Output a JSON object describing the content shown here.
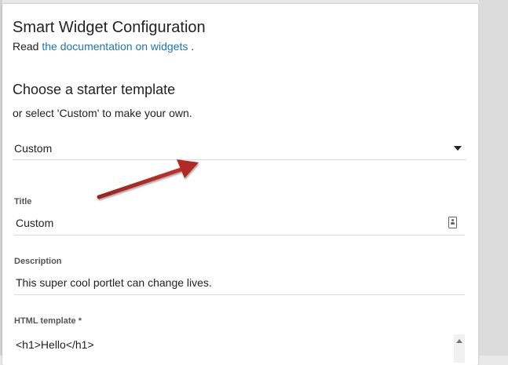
{
  "panel": {
    "title": "Smart Widget Configuration",
    "read_prefix": "Read ",
    "doc_link": "the documentation on widgets",
    "read_suffix": " ."
  },
  "starter": {
    "heading": "Choose a starter template",
    "subtext": "or select 'Custom' to make your own.",
    "selected": "Custom"
  },
  "fields": {
    "title_label": "Title",
    "title_value": "Custom",
    "description_label": "Description",
    "description_value": "This super cool portlet can change lives.",
    "html_label": "HTML template *",
    "html_value": "<h1>Hello</h1>"
  },
  "icons": {
    "title_field_icon": "contact-card-icon",
    "select_caret": "caret-down-icon",
    "scroll_up": "scroll-up-arrow-icon",
    "annotation_arrow": "annotation-arrow-icon"
  },
  "colors": {
    "link": "#1b76b5",
    "arrow": "#b32a25"
  }
}
